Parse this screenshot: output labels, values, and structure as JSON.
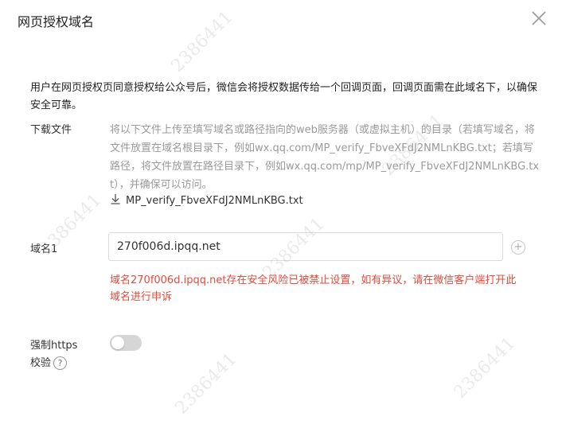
{
  "dialog": {
    "title": "网页授权域名",
    "close_icon": "close-icon"
  },
  "intro": "用户在网页授权页同意授权给公众号后，微信会将授权数据传给一个回调页面，回调页面需在此域名下，以确保安全可靠。",
  "download": {
    "label": "下载文件",
    "description": "将以下文件上传至填写域名或路径指向的web服务器（或虚拟主机）的目录（若填写域名，将文件放置在域名根目录下，例如wx.qq.com/MP_verify_FbveXFdJ2NMLnKBG.txt；若填写路径，将文件放置在路径目录下，例如wx.qq.com/mp/MP_verify_FbveXFdJ2NMLnKBG.txt），并确保可以访问。",
    "file_name": "MP_verify_FbveXFdJ2NMLnKBG.txt",
    "icon": "download-icon"
  },
  "domain": {
    "label": "域名1",
    "value": "270f006d.ipqq.net",
    "add_icon": "plus-icon",
    "error": "域名270f006d.ipqq.net存在安全风险已被禁止设置，如有异议，请在微信客户端打开此域名进行申诉"
  },
  "https": {
    "label_line1": "强制https",
    "label_line2": "校验",
    "help_icon": "question-icon",
    "enabled": false
  },
  "colors": {
    "error": "#e24b3b",
    "muted": "#9a9a9a",
    "toggle_off": "#d6d6d6"
  }
}
